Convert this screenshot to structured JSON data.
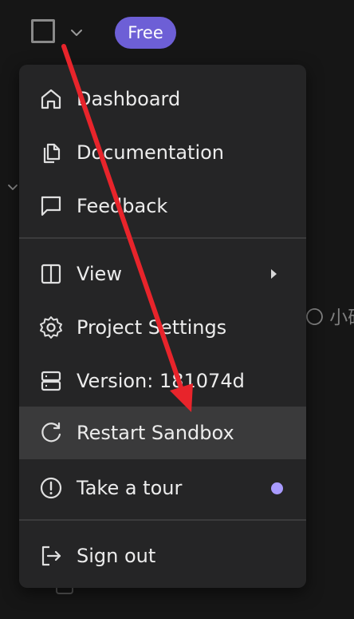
{
  "header": {
    "plan_badge": "Free"
  },
  "background": {
    "partial_text": "〇 小研"
  },
  "menu": {
    "items": [
      {
        "label": "Dashboard",
        "icon": "home-icon"
      },
      {
        "label": "Documentation",
        "icon": "documents-icon"
      },
      {
        "label": "Feedback",
        "icon": "message-square-icon"
      },
      {
        "label": "View",
        "icon": "columns-icon",
        "has_submenu": true
      },
      {
        "label": "Project Settings",
        "icon": "gear-icon"
      },
      {
        "label": "Version: 181074d",
        "icon": "server-icon"
      },
      {
        "label": "Restart Sandbox",
        "icon": "refresh-icon",
        "highlighted": true
      },
      {
        "label": "Take a tour",
        "icon": "info-circle-icon",
        "badge_color": "#a99bff"
      },
      {
        "label": "Sign out",
        "icon": "sign-out-icon"
      }
    ]
  },
  "annotation": {
    "arrow_color": "#e8242b"
  },
  "colors": {
    "menu_bg": "#252526",
    "highlight_bg": "#3a3a3b",
    "badge_bg": "#6d5fd6"
  }
}
